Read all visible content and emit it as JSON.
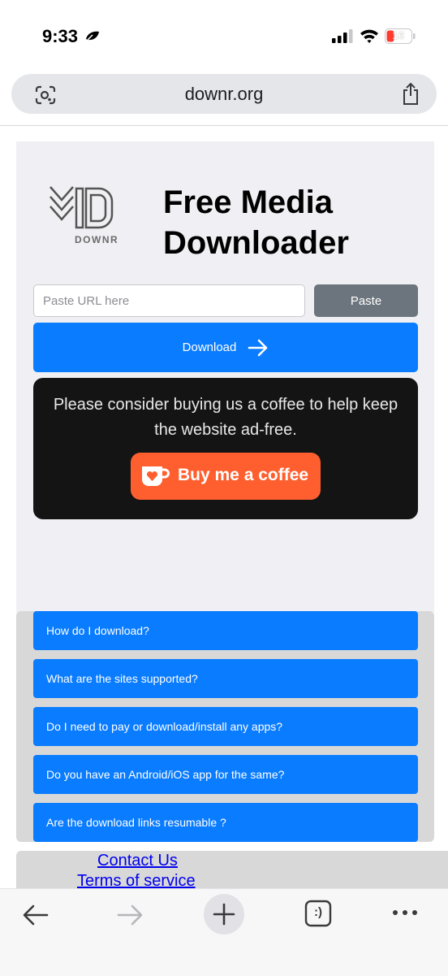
{
  "status": {
    "time": "9:33",
    "battery": "16"
  },
  "browser": {
    "url": "downr.org"
  },
  "hero": {
    "logo_text": "DOWNR",
    "title": "Free Media Downloader"
  },
  "form": {
    "placeholder": "Paste URL here",
    "paste_label": "Paste",
    "download_label": "Download"
  },
  "coffee": {
    "message": "Please consider buying us a coffee to help keep the website ad-free.",
    "button_label": "Buy me a coffee"
  },
  "faq": [
    "How do I download?",
    "What are the sites supported?",
    "Do I need to pay or download/install any apps?",
    "Do you have an Android/iOS app for the same?",
    "Are the download links resumable ?"
  ],
  "footer": {
    "contact": "Contact Us",
    "terms": "Terms of service"
  },
  "toolbar": {
    "tabs_label": ":)"
  },
  "colors": {
    "primary": "#0a7cff",
    "secondary": "#6c757d",
    "coffee_button": "#ff5f2e",
    "coffee_card": "#141414",
    "link": "#0000ee"
  }
}
